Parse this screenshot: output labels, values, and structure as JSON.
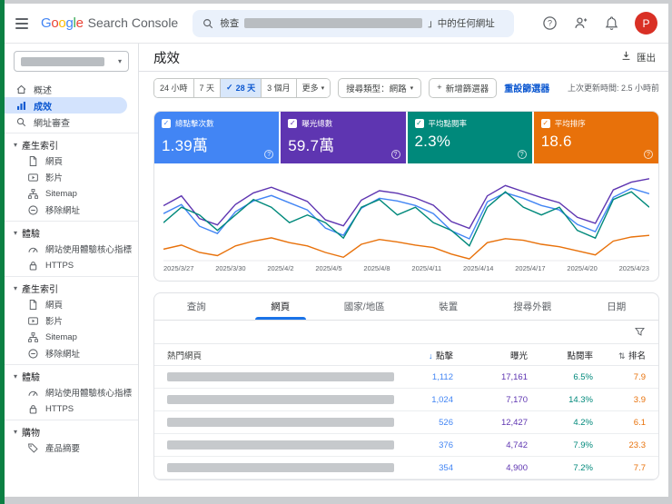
{
  "glyphs": {
    "caret_down": "▾",
    "check": "✓"
  },
  "colors": {
    "clicks": "#4285f4",
    "impressions": "#5e35b1",
    "ctr": "#00897b",
    "position": "#e8710a",
    "accent_blue": "#0b57d0",
    "active_tab_underline": "#1a73e8",
    "selected_pill": "#d3e3fd",
    "google_letters": [
      "#4285F4",
      "#EA4335",
      "#FBBC05",
      "#4285F4",
      "#34A853",
      "#EA4335"
    ],
    "avatar_bg": "#d93025",
    "left_edge_strip": "#0b8043"
  },
  "topbar": {
    "logo_google": "Google",
    "logo_suffix": "Search Console",
    "search_prefix": "檢查",
    "search_suffix": "」中的任何網址",
    "icons": [
      "search-icon",
      "help-icon",
      "add-user-icon",
      "notifications-icon"
    ],
    "avatar_letter": "P"
  },
  "sidebar": {
    "items": [
      {
        "type": "item",
        "icon": "overview",
        "label": "概述"
      },
      {
        "type": "item",
        "icon": "performance",
        "label": "成效",
        "selected": true
      },
      {
        "type": "item",
        "icon": "inspect",
        "label": "網址審查"
      },
      {
        "type": "divider"
      },
      {
        "type": "section",
        "label": "產生索引"
      },
      {
        "type": "sub",
        "icon": "page",
        "label": "網頁"
      },
      {
        "type": "sub",
        "icon": "video",
        "label": "影片"
      },
      {
        "type": "sub",
        "icon": "sitemap",
        "label": "Sitemap"
      },
      {
        "type": "sub",
        "icon": "remove",
        "label": "移除網址"
      },
      {
        "type": "divider"
      },
      {
        "type": "section",
        "label": "體驗"
      },
      {
        "type": "sub",
        "icon": "cwv",
        "label": "網站使用體驗核心指標"
      },
      {
        "type": "sub",
        "icon": "https",
        "label": "HTTPS"
      },
      {
        "type": "divider"
      },
      {
        "type": "section",
        "label": "產生索引"
      },
      {
        "type": "sub",
        "icon": "page",
        "label": "網頁"
      },
      {
        "type": "sub",
        "icon": "video",
        "label": "影片"
      },
      {
        "type": "sub",
        "icon": "sitemap",
        "label": "Sitemap"
      },
      {
        "type": "sub",
        "icon": "remove",
        "label": "移除網址"
      },
      {
        "type": "divider"
      },
      {
        "type": "section",
        "label": "體驗"
      },
      {
        "type": "sub",
        "icon": "cwv",
        "label": "網站使用體驗核心指標"
      },
      {
        "type": "sub",
        "icon": "https",
        "label": "HTTPS"
      },
      {
        "type": "divider"
      },
      {
        "type": "section",
        "label": "購物"
      },
      {
        "type": "sub",
        "icon": "product",
        "label": "產品摘要"
      }
    ]
  },
  "header": {
    "title": "成效",
    "export_label": "匯出"
  },
  "filters": {
    "date_options": [
      {
        "label": "24 小時"
      },
      {
        "label": "7 天"
      },
      {
        "label": "28 天",
        "selected": true
      },
      {
        "label": "3 個月"
      },
      {
        "label": "更多",
        "caret": true
      }
    ],
    "search_type_label": "搜尋類型：網路",
    "add_filter_plus": "+",
    "add_filter_label": "新增篩選器",
    "reset_label": "重設篩選器",
    "last_updated": "上次更新時間: 2.5 小時前"
  },
  "cards": [
    {
      "key": "clicks",
      "label": "總點擊次數",
      "value": "1.39萬",
      "color": "#4285f4",
      "checked": true
    },
    {
      "key": "impressions",
      "label": "曝光總數",
      "value": "59.7萬",
      "color": "#5e35b1",
      "checked": true
    },
    {
      "key": "ctr",
      "label": "平均點閱率",
      "value": "2.3%",
      "color": "#00897b",
      "checked": true
    },
    {
      "key": "position",
      "label": "平均排序",
      "value": "18.6",
      "color": "#e8710a",
      "checked": true
    }
  ],
  "chart_data": {
    "type": "line",
    "title": "成效 (Performance over time)",
    "grid": false,
    "legend": "none — metric cards above act as series toggles",
    "x": [
      "2025/3/27",
      "2025/3/28",
      "2025/3/29",
      "2025/3/30",
      "2025/3/31",
      "2025/4/1",
      "2025/4/2",
      "2025/4/3",
      "2025/4/4",
      "2025/4/5",
      "2025/4/6",
      "2025/4/7",
      "2025/4/8",
      "2025/4/9",
      "2025/4/10",
      "2025/4/11",
      "2025/4/12",
      "2025/4/13",
      "2025/4/14",
      "2025/4/15",
      "2025/4/16",
      "2025/4/17",
      "2025/4/18",
      "2025/4/19",
      "2025/4/20",
      "2025/4/21",
      "2025/4/22",
      "2025/4/23"
    ],
    "x_tick_labels": [
      "2025/3/27",
      "2025/3/30",
      "2025/4/2",
      "2025/4/5",
      "2025/4/8",
      "2025/4/11",
      "2025/4/14",
      "2025/4/17",
      "2025/4/20",
      "2025/4/23"
    ],
    "series": [
      {
        "key": "clicks",
        "name": "總點擊次數",
        "total": "1.39萬",
        "color": "#4285f4",
        "values": [
          470,
          520,
          400,
          360,
          480,
          540,
          570,
          530,
          490,
          390,
          350,
          500,
          555,
          540,
          515,
          470,
          375,
          330,
          535,
          585,
          555,
          515,
          490,
          410,
          370,
          560,
          610,
          580
        ]
      },
      {
        "key": "impressions",
        "name": "曝光總數",
        "total": "59.7萬",
        "color": "#5e35b1",
        "values": [
          20500,
          22800,
          17500,
          16000,
          20800,
          23500,
          24800,
          23200,
          21500,
          17200,
          15800,
          21800,
          24000,
          23400,
          22300,
          20600,
          16800,
          15200,
          22800,
          25200,
          23800,
          22400,
          21200,
          17800,
          16400,
          24200,
          26000,
          26800
        ]
      },
      {
        "key": "ctr",
        "name": "平均點閱率",
        "total": "2.3%",
        "unit": "%",
        "color": "#00897b",
        "values": [
          2.2,
          2.4,
          2.3,
          2.1,
          2.3,
          2.5,
          2.4,
          2.2,
          2.3,
          2.2,
          2.0,
          2.4,
          2.5,
          2.3,
          2.4,
          2.2,
          2.1,
          1.9,
          2.4,
          2.6,
          2.4,
          2.3,
          2.4,
          2.1,
          2.0,
          2.5,
          2.6,
          2.4
        ]
      },
      {
        "key": "position",
        "name": "平均排序",
        "total": "18.6",
        "color": "#e8710a",
        "inverted_axis": true,
        "values": [
          19.4,
          18.9,
          19.8,
          20.2,
          19.0,
          18.4,
          18.0,
          18.6,
          19.0,
          19.8,
          20.4,
          18.8,
          18.2,
          18.5,
          18.9,
          19.2,
          20.0,
          20.6,
          18.6,
          18.1,
          18.3,
          18.8,
          19.1,
          19.6,
          20.1,
          18.4,
          17.9,
          17.7
        ]
      }
    ]
  },
  "tabs": {
    "items": [
      "查詢",
      "網頁",
      "國家/地區",
      "裝置",
      "搜尋外觀",
      "日期"
    ],
    "active": "網頁"
  },
  "table": {
    "first_column": "熱門網頁",
    "columns": [
      {
        "key": "clicks",
        "label": "點擊",
        "sort": "desc",
        "sort_glyph": "↓"
      },
      {
        "key": "impressions",
        "label": "曝光"
      },
      {
        "key": "ctr",
        "label": "點閱率"
      },
      {
        "key": "position",
        "label": "排名",
        "sort": "both",
        "sort_glyph": "⇅"
      }
    ],
    "rows": [
      {
        "clicks": "1,112",
        "impressions": "17,161",
        "ctr": "6.5%",
        "position": "7.9"
      },
      {
        "clicks": "1,024",
        "impressions": "7,170",
        "ctr": "14.3%",
        "position": "3.9"
      },
      {
        "clicks": "526",
        "impressions": "12,427",
        "ctr": "4.2%",
        "position": "6.1"
      },
      {
        "clicks": "376",
        "impressions": "4,742",
        "ctr": "7.9%",
        "position": "23.3"
      },
      {
        "clicks": "354",
        "impressions": "4,900",
        "ctr": "7.2%",
        "position": "7.7"
      }
    ]
  }
}
